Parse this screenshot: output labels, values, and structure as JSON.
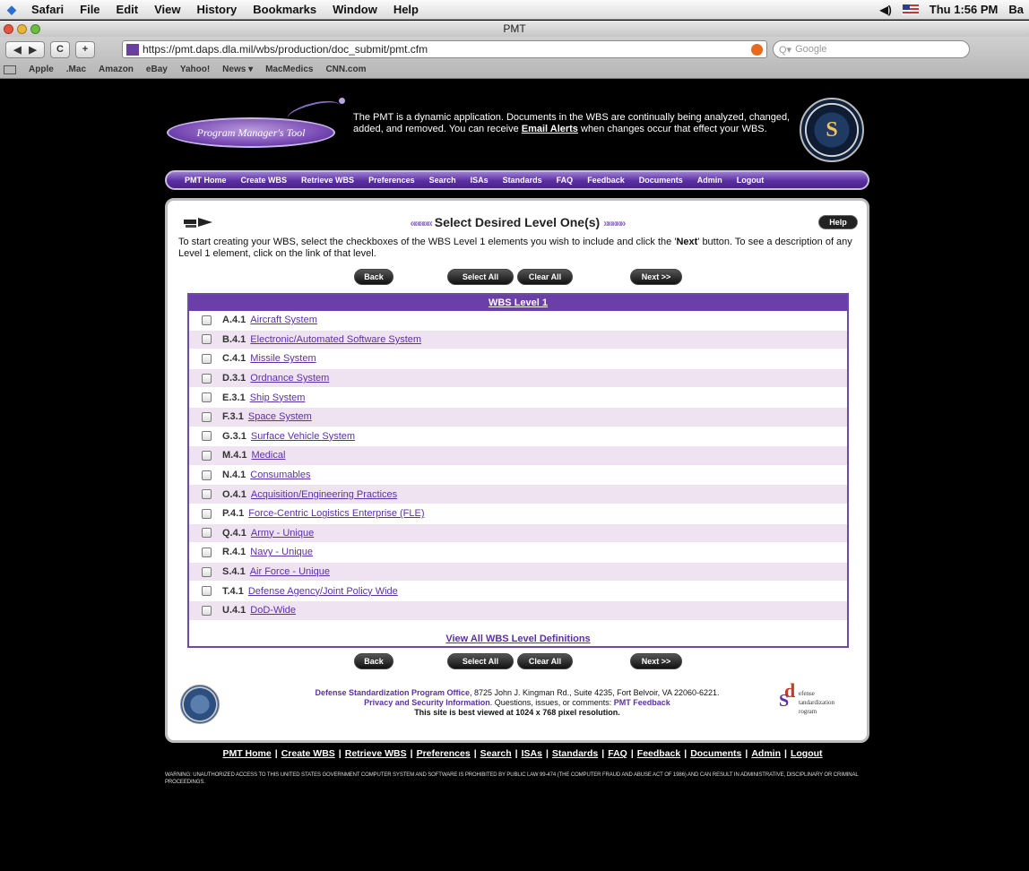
{
  "menubar": {
    "app": "Safari",
    "items": [
      "File",
      "Edit",
      "View",
      "History",
      "Bookmarks",
      "Window",
      "Help"
    ],
    "clock": "Thu 1:56 PM",
    "user": "Ba"
  },
  "window": {
    "title": "PMT"
  },
  "toolbar": {
    "url": "https://pmt.daps.dla.mil/wbs/production/doc_submit/pmt.cfm",
    "search_placeholder": "Google",
    "reload_label": "C",
    "add_label": "+",
    "bookmarks": [
      "Apple",
      ".Mac",
      "Amazon",
      "eBay",
      "Yahoo!",
      "News ▾",
      "MacMedics",
      "CNN.com"
    ]
  },
  "header": {
    "logo_text": "Program Manager's Tool",
    "intro_before": "The PMT is a dynamic application. Documents in the WBS are continually being analyzed, changed, added, and removed. You can receive ",
    "intro_link": "Email Alerts",
    "intro_after": " when changes occur that effect your WBS.",
    "seal_letter": "S"
  },
  "nav": [
    "PMT Home",
    "Create WBS",
    "Retrieve WBS",
    "Preferences",
    "Search",
    "ISAs",
    "Standards",
    "FAQ",
    "Feedback",
    "Documents",
    "Admin",
    "Logout"
  ],
  "panel": {
    "chevrons_left": "«««««",
    "title": "Select Desired Level One(s)",
    "chevrons_right": "»»»»»",
    "help": "Help",
    "instr_before": "To start creating your WBS, select the checkboxes of the WBS Level 1 elements you wish to include and click the '",
    "instr_bold": "Next",
    "instr_after": "' button. To see a description of any Level 1 element, click on the link of that level.",
    "buttons": {
      "back": "Back",
      "select_all": "Select All",
      "clear_all": "Clear All",
      "next": "Next >>"
    },
    "table_header": "WBS Level 1",
    "rows": [
      {
        "code": "A.4.1",
        "label": "Aircraft System"
      },
      {
        "code": "B.4.1",
        "label": "Electronic/Automated Software System"
      },
      {
        "code": "C.4.1",
        "label": "Missile System"
      },
      {
        "code": "D.3.1",
        "label": "Ordnance System"
      },
      {
        "code": "E.3.1",
        "label": "Ship System"
      },
      {
        "code": "F.3.1",
        "label": "Space System"
      },
      {
        "code": "G.3.1",
        "label": "Surface Vehicle System"
      },
      {
        "code": "M.4.1",
        "label": "Medical"
      },
      {
        "code": "N.4.1",
        "label": "Consumables"
      },
      {
        "code": "O.4.1",
        "label": "Acquisition/Engineering Practices"
      },
      {
        "code": "P.4.1",
        "label": "Force-Centric Logistics Enterprise (FLE)"
      },
      {
        "code": "Q.4.1",
        "label": "Army - Unique"
      },
      {
        "code": "R.4.1",
        "label": "Navy - Unique"
      },
      {
        "code": "S.4.1",
        "label": "Air Force - Unique"
      },
      {
        "code": "T.4.1",
        "label": "Defense Agency/Joint Policy Wide"
      },
      {
        "code": "U.4.1",
        "label": "DoD-Wide"
      }
    ],
    "view_all": "View All WBS Level Definitions"
  },
  "footer": {
    "office": "Defense Standardization Program Office",
    "address": ", 8725 John J. Kingman Rd., Suite 4235, Fort Belvoir, VA 22060-6221.",
    "privacy": "Privacy and Security Information",
    "questions": ". Questions, issues, or comments: ",
    "feedback": "PMT Feedback",
    "resolution": "This site is best viewed at 1024 x 768 pixel resolution.",
    "dsp_d": "d",
    "dsp_s": "S",
    "dsp_line1": "efense",
    "dsp_line2": "tandardization",
    "dsp_line3": "rogram"
  },
  "bottom_links": [
    "PMT Home",
    "Create WBS",
    "Retrieve WBS",
    "Preferences",
    "Search",
    "ISAs",
    "Standards",
    "FAQ",
    "Feedback",
    "Documents",
    "Admin",
    "Logout"
  ],
  "warning": "WARNING: UNAUTHORIZED ACCESS TO THIS UNITED STATES GOVERNMENT COMPUTER SYSTEM AND SOFTWARE IS PROHIBITED BY PUBLIC LAW 99-474 (THE COMPUTER FRAUD AND ABUSE ACT OF 1986) AND CAN RESULT IN ADMINISTRATIVE, DISCIPLINARY OR CRIMINAL PROCEEDINGS.",
  "colors": {
    "accent": "#5d2fa6",
    "nav_purple": "#5b2ea3",
    "row_alt": "#efe3f2"
  }
}
